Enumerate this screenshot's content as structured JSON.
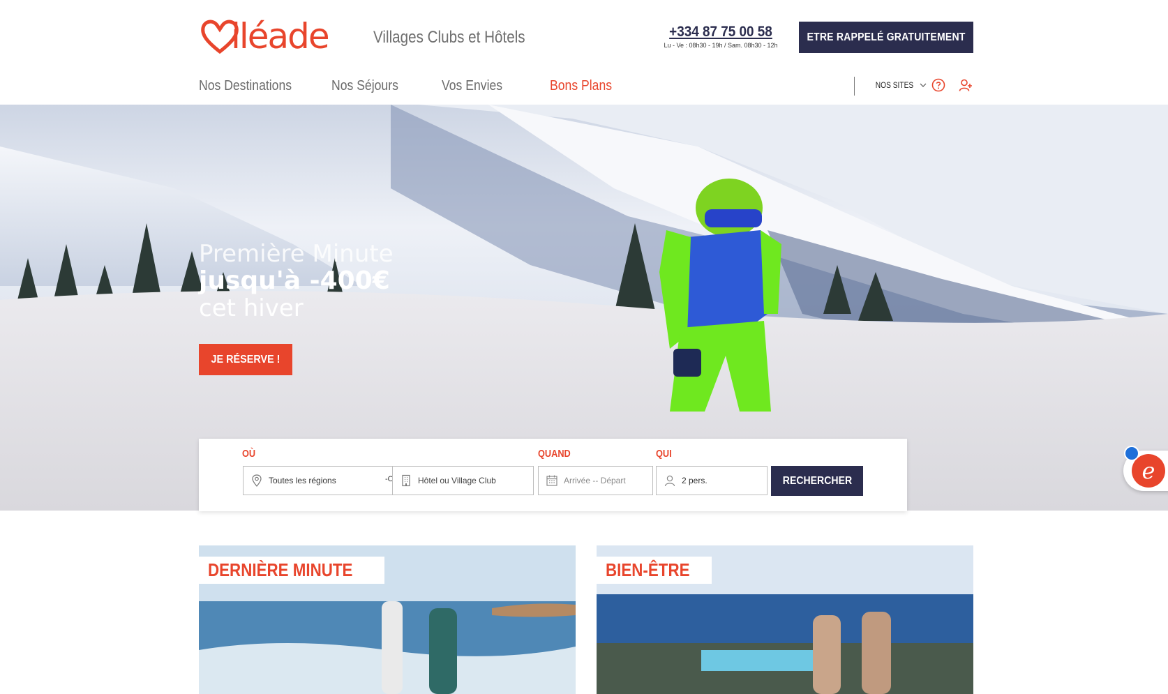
{
  "brand": {
    "logo_text": "iléade",
    "tagline": "Villages Clubs et Hôtels",
    "accent_color": "#e8452c",
    "dark_color": "#2b2d4e"
  },
  "contact": {
    "phone": "+334 87 75 00 58",
    "hours": "Lu - Ve : 08h30 - 19h / Sam. 08h30 - 12h",
    "callback_label": "ETRE RAPPELÉ GRATUITEMENT"
  },
  "nav": {
    "items": [
      {
        "label": "Nos Destinations"
      },
      {
        "label": "Nos Séjours"
      },
      {
        "label": "Vos Envies"
      },
      {
        "label": "Bons Plans"
      }
    ],
    "nos_sites_label": "NOS SITES",
    "help_icon": "question-circle-icon",
    "account_icon": "user-plus-icon"
  },
  "hero": {
    "line1": "Première Minute",
    "line2": "jusqu'à -400€",
    "line3": "cet hiver",
    "cta_label": "JE RÉSERVE !"
  },
  "search": {
    "where_label": "OÙ",
    "when_label": "QUAND",
    "who_label": "QUI",
    "region_value": "Toutes les régions",
    "or_label": "-Ou-",
    "hotel_placeholder": "Hôtel ou Village Club",
    "dates_placeholder": "Arrivée -- Départ",
    "persons_value": "2 pers.",
    "submit_label": "RECHERCHER"
  },
  "chat": {
    "icon": "chat-e-icon",
    "glyph": "e"
  },
  "cards": [
    {
      "label": "DERNIÈRE MINUTE"
    },
    {
      "label": "BIEN-ÊTRE"
    }
  ]
}
